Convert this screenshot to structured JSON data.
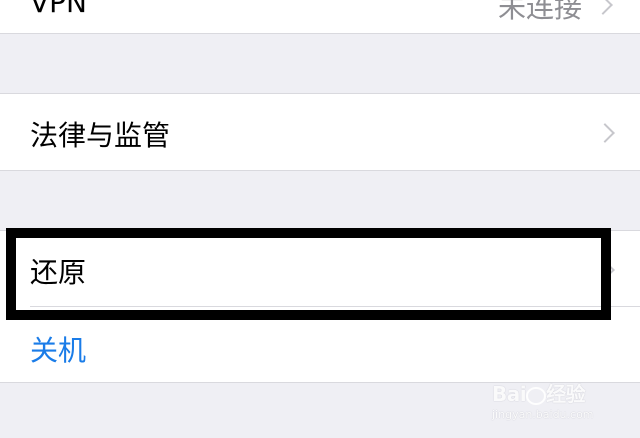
{
  "rows": {
    "vpn": {
      "label": "VPN",
      "value": "未连接"
    },
    "legal": {
      "label": "法律与监管"
    },
    "reset": {
      "label": "还原"
    },
    "shutdown": {
      "label": "关机"
    }
  },
  "colors": {
    "background": "#efeff4",
    "row_background": "#ffffff",
    "link_blue": "#1a7ce8",
    "value_gray": "#8e8e93",
    "chevron_gray": "#c7c7cc",
    "highlight": "#000000"
  },
  "watermark": {
    "brand_left": "Bai",
    "brand_right": "经验",
    "domain": "jingyan.baidu.com"
  }
}
